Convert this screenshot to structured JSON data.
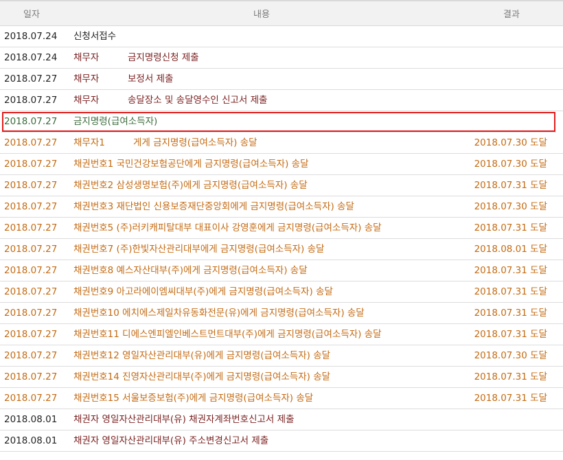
{
  "columns": {
    "date": "일자",
    "content": "내용",
    "result": "결과"
  },
  "rows": [
    {
      "date": "2018.07.24",
      "party": "신청서접수",
      "desc": "",
      "full": "",
      "result": "",
      "date_color": "#222222",
      "text_color": "#222222",
      "selected": false
    },
    {
      "date": "2018.07.24",
      "party": "채무자",
      "desc": "금지명령신청 제출",
      "full": "",
      "result": "",
      "date_color": "#222222",
      "text_color": "#7a1f1f",
      "selected": false
    },
    {
      "date": "2018.07.27",
      "party": "채무자",
      "desc": "보정서 제출",
      "full": "",
      "result": "",
      "date_color": "#222222",
      "text_color": "#7a1f1f",
      "selected": false
    },
    {
      "date": "2018.07.27",
      "party": "채무자",
      "desc": "송달장소 및 송달영수인 신고서 제출",
      "full": "",
      "result": "",
      "date_color": "#222222",
      "text_color": "#7a1f1f",
      "selected": false
    },
    {
      "date": "2018.07.27",
      "party": "금지명령(급여소득자)",
      "desc": "",
      "full": "",
      "result": "",
      "date_color": "#3b6b3b",
      "text_color": "#3b6b3b",
      "selected": true
    },
    {
      "date": "2018.07.27",
      "party": "채무자1",
      "desc": "게게 금지명령(급여소득자) 송달",
      "full": "",
      "result": "2018.07.30 도달",
      "date_color": "#c46a12",
      "text_color": "#c46a12",
      "selected": false,
      "desc_offset": true
    },
    {
      "date": "2018.07.27",
      "party": "",
      "desc": "",
      "full": "채권번호1 국민건강보험공단에게 금지명령(급여소득자) 송달",
      "result": "2018.07.30 도달",
      "date_color": "#c46a12",
      "text_color": "#c46a12",
      "selected": false
    },
    {
      "date": "2018.07.27",
      "party": "",
      "desc": "",
      "full": "채권번호2 삼성생명보험(주)에게 금지명령(급여소득자) 송달",
      "result": "2018.07.31 도달",
      "date_color": "#c46a12",
      "text_color": "#c46a12",
      "selected": false
    },
    {
      "date": "2018.07.27",
      "party": "",
      "desc": "",
      "full": "채권번호3 재단법인 신용보증재단중앙회에게 금지명령(급여소득자) 송달",
      "result": "2018.07.30 도달",
      "date_color": "#c46a12",
      "text_color": "#c46a12",
      "selected": false
    },
    {
      "date": "2018.07.27",
      "party": "",
      "desc": "",
      "full": "채권번호5 (주)러키캐피탈대부 대표이사 강영훈에게 금지명령(급여소득자) 송달",
      "result": "2018.07.31 도달",
      "date_color": "#c46a12",
      "text_color": "#c46a12",
      "selected": false
    },
    {
      "date": "2018.07.27",
      "party": "",
      "desc": "",
      "full": "채권번호7 (주)한빛자산관리대부에게 금지명령(급여소득자) 송달",
      "result": "2018.08.01 도달",
      "date_color": "#c46a12",
      "text_color": "#c46a12",
      "selected": false
    },
    {
      "date": "2018.07.27",
      "party": "",
      "desc": "",
      "full": "채권번호8 예스자산대부(주)에게 금지명령(급여소득자) 송달",
      "result": "2018.07.31 도달",
      "date_color": "#c46a12",
      "text_color": "#c46a12",
      "selected": false
    },
    {
      "date": "2018.07.27",
      "party": "",
      "desc": "",
      "full": "채권번호9 아고라에이엠씨대부(주)에게 금지명령(급여소득자) 송달",
      "result": "2018.07.31 도달",
      "date_color": "#c46a12",
      "text_color": "#c46a12",
      "selected": false
    },
    {
      "date": "2018.07.27",
      "party": "",
      "desc": "",
      "full": "채권번호10 에치에스제일차유동화전문(유)에게 금지명령(급여소득자) 송달",
      "result": "2018.07.31 도달",
      "date_color": "#c46a12",
      "text_color": "#c46a12",
      "selected": false
    },
    {
      "date": "2018.07.27",
      "party": "",
      "desc": "",
      "full": "채권번호11 디에스엔피엘인베스트먼트대부(주)에게 금지명령(급여소득자) 송달",
      "result": "2018.07.31 도달",
      "date_color": "#c46a12",
      "text_color": "#c46a12",
      "selected": false
    },
    {
      "date": "2018.07.27",
      "party": "",
      "desc": "",
      "full": "채권번호12 영일자산관리대부(유)에게 금지명령(급여소득자) 송달",
      "result": "2018.07.30 도달",
      "date_color": "#c46a12",
      "text_color": "#c46a12",
      "selected": false
    },
    {
      "date": "2018.07.27",
      "party": "",
      "desc": "",
      "full": "채권번호14 진영자산관리대부(주)에게 금지명령(급여소득자) 송달",
      "result": "2018.07.31 도달",
      "date_color": "#c46a12",
      "text_color": "#c46a12",
      "selected": false
    },
    {
      "date": "2018.07.27",
      "party": "",
      "desc": "",
      "full": "채권번호15 서울보증보험(주)에게 금지명령(급여소득자) 송달",
      "result": "2018.07.31 도달",
      "date_color": "#c46a12",
      "text_color": "#c46a12",
      "selected": false
    },
    {
      "date": "2018.08.01",
      "party": "",
      "desc": "",
      "full": "채권자 영일자산관리대부(유) 채권자계좌번호신고서 제출",
      "result": "",
      "date_color": "#222222",
      "text_color": "#7a1f1f",
      "selected": false
    },
    {
      "date": "2018.08.01",
      "party": "",
      "desc": "",
      "full": "채권자 영일자산관리대부(유) 주소변경신고서 제출",
      "result": "",
      "date_color": "#222222",
      "text_color": "#7a1f1f",
      "selected": false
    }
  ]
}
